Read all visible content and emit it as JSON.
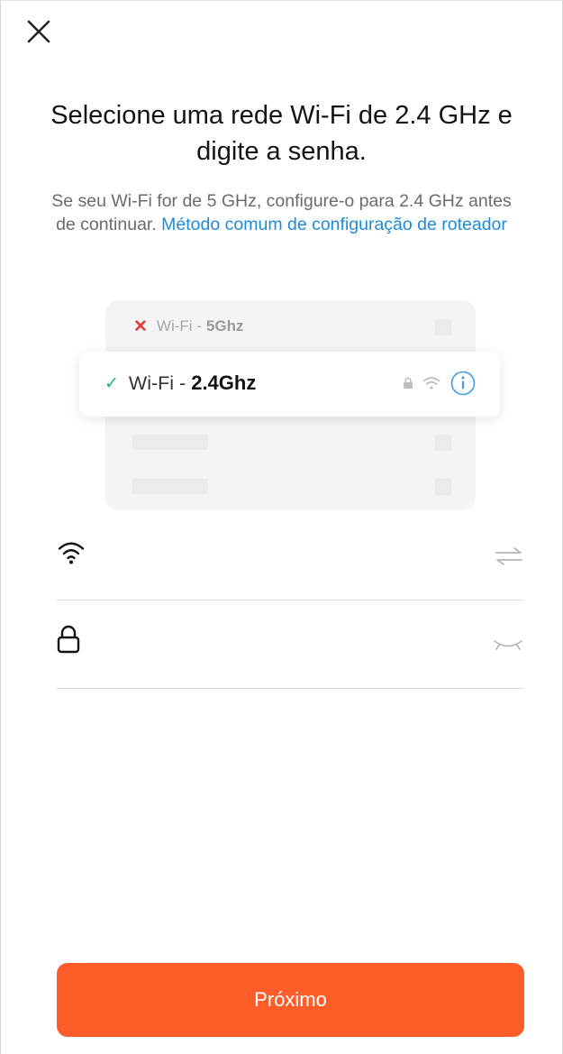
{
  "header": {
    "close_icon": "close-icon"
  },
  "title": "Selecione uma rede Wi-Fi de 2.4 GHz e digite a senha.",
  "subtitle": {
    "text": "Se seu Wi-Fi for de 5 GHz, configure-o para 2.4 GHz antes de continuar.",
    "link": "Método comum de configuração de roteador"
  },
  "illustration": {
    "row_5ghz": {
      "prefix": "Wi-Fi -",
      "band": "5Ghz"
    },
    "row_24ghz": {
      "prefix": "Wi-Fi -",
      "band": "2.4Ghz"
    },
    "icons": [
      "lock-icon",
      "wifi-signal-icon",
      "info-icon"
    ]
  },
  "form": {
    "ssid": {
      "icon": "wifi-icon",
      "value": "",
      "trail_icon": "switch-network-icon"
    },
    "password": {
      "icon": "lock-icon",
      "value": "",
      "trail_icon": "eye-closed-icon"
    }
  },
  "actions": {
    "next_label": "Próximo"
  },
  "colors": {
    "accent": "#fe5c29",
    "link": "#1f8bd6",
    "check": "#1fb38a",
    "error": "#ee3535"
  }
}
